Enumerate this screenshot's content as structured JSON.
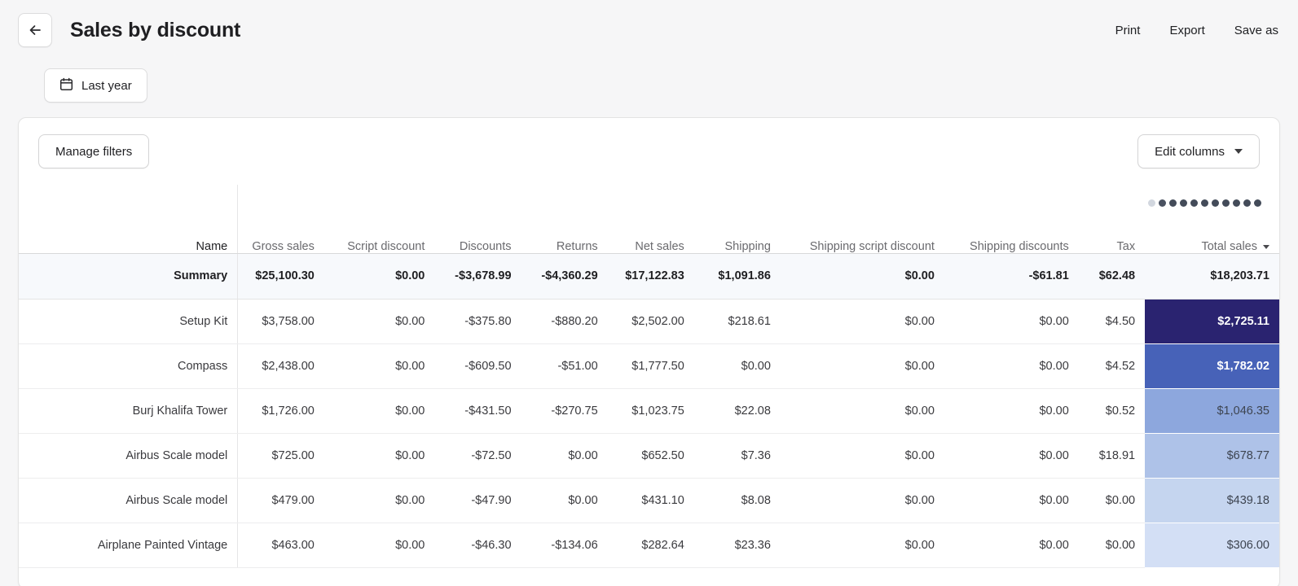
{
  "header": {
    "title": "Sales by discount",
    "back_icon": "arrow-left-icon",
    "actions": [
      {
        "label": "Print",
        "name": "print-button"
      },
      {
        "label": "Export",
        "name": "export-button"
      },
      {
        "label": "Save as",
        "name": "save-as-button"
      }
    ]
  },
  "filters": {
    "date_range_label": "Last year",
    "date_icon": "calendar-icon"
  },
  "toolbar": {
    "manage_filters_label": "Manage filters",
    "edit_columns_label": "Edit columns",
    "edit_columns_caret": "chevron-down-icon"
  },
  "table": {
    "sort_column": "Total sales",
    "sort_caret": "chevron-down-icon",
    "columns": [
      "Name",
      "Gross sales",
      "Script discount",
      "Discounts",
      "Returns",
      "Net sales",
      "Shipping",
      "Shipping script discount",
      "Shipping discounts",
      "Tax",
      "Total sales"
    ],
    "dot_scale": [
      "#9aa3b0",
      "#d6dae1",
      "#e3e7ed",
      "#d2d7df",
      "#4a5261",
      "#434b59",
      "#434b59",
      "#434b59",
      "#434b59",
      "#434b59",
      "#434b59",
      "#434b59",
      "#434b59",
      "#434b59"
    ],
    "summary": {
      "name": "Summary",
      "gross_sales": "$25,100.30",
      "script_discount": "$0.00",
      "discounts": "-$3,678.99",
      "returns": "-$4,360.29",
      "net_sales": "$17,122.83",
      "shipping": "$1,091.86",
      "shipping_script_discount": "$0.00",
      "shipping_discounts": "-$61.81",
      "tax": "$62.48",
      "total_sales": "$18,203.71"
    },
    "rows": [
      {
        "name": "Setup Kit",
        "gross_sales": "$3,758.00",
        "script_discount": "$0.00",
        "discounts": "-$375.80",
        "returns": "-$880.20",
        "net_sales": "$2,502.00",
        "shipping": "$218.61",
        "shipping_script_discount": "$0.00",
        "shipping_discounts": "$0.00",
        "tax": "$4.50",
        "total_sales": "$2,725.11",
        "heat_color": "#2a2370",
        "heat_text": "light"
      },
      {
        "name": "Compass",
        "gross_sales": "$2,438.00",
        "script_discount": "$0.00",
        "discounts": "-$609.50",
        "returns": "-$51.00",
        "net_sales": "$1,777.50",
        "shipping": "$0.00",
        "shipping_script_discount": "$0.00",
        "shipping_discounts": "$0.00",
        "tax": "$4.52",
        "total_sales": "$1,782.02",
        "heat_color": "#4762b8",
        "heat_text": "light"
      },
      {
        "name": "Burj Khalifa Tower",
        "gross_sales": "$1,726.00",
        "script_discount": "$0.00",
        "discounts": "-$431.50",
        "returns": "-$270.75",
        "net_sales": "$1,023.75",
        "shipping": "$22.08",
        "shipping_script_discount": "$0.00",
        "shipping_discounts": "$0.00",
        "tax": "$0.52",
        "total_sales": "$1,046.35",
        "heat_color": "#8da7dd",
        "heat_text": "dark"
      },
      {
        "name": "Airbus Scale model",
        "gross_sales": "$725.00",
        "script_discount": "$0.00",
        "discounts": "-$72.50",
        "returns": "$0.00",
        "net_sales": "$652.50",
        "shipping": "$7.36",
        "shipping_script_discount": "$0.00",
        "shipping_discounts": "$0.00",
        "tax": "$18.91",
        "total_sales": "$678.77",
        "heat_color": "#aec2e8",
        "heat_text": "dark"
      },
      {
        "name": "Airbus Scale model",
        "gross_sales": "$479.00",
        "script_discount": "$0.00",
        "discounts": "-$47.90",
        "returns": "$0.00",
        "net_sales": "$431.10",
        "shipping": "$8.08",
        "shipping_script_discount": "$0.00",
        "shipping_discounts": "$0.00",
        "tax": "$0.00",
        "total_sales": "$439.18",
        "heat_color": "#c5d5ef",
        "heat_text": "dark"
      },
      {
        "name": "Airplane Painted Vintage",
        "gross_sales": "$463.00",
        "script_discount": "$0.00",
        "discounts": "-$46.30",
        "returns": "-$134.06",
        "net_sales": "$282.64",
        "shipping": "$23.36",
        "shipping_script_discount": "$0.00",
        "shipping_discounts": "$0.00",
        "tax": "$0.00",
        "total_sales": "$306.00",
        "heat_color": "#d3dff5",
        "heat_text": "dark"
      }
    ]
  }
}
